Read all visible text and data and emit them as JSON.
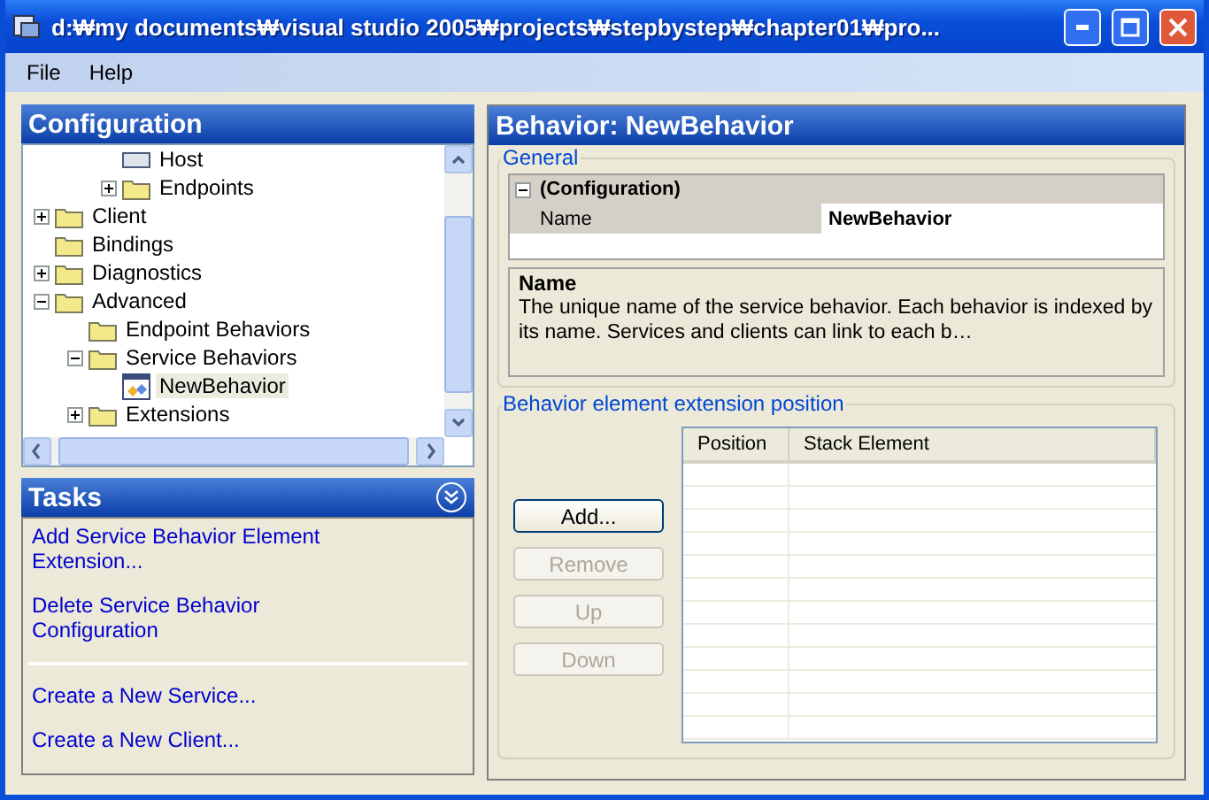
{
  "window": {
    "title": "d:₩my documents₩visual studio 2005₩projects₩stepbystep₩chapter01₩pro..."
  },
  "menu": [
    "File",
    "Help"
  ],
  "configuration": {
    "title": "Configuration",
    "tree": [
      {
        "children": [
          {
            "children": [
              {
                "label": "Host",
                "kind": "host",
                "selected": false
              },
              {
                "label": "Endpoints",
                "kind": "folder",
                "expanded": false,
                "selected": false
              }
            ]
          }
        ]
      },
      {
        "label": "Client",
        "kind": "folder",
        "expanded": false,
        "selected": false
      },
      {
        "label": "Bindings",
        "kind": "folder",
        "selected": false
      },
      {
        "label": "Diagnostics",
        "kind": "folder",
        "expanded": false,
        "selected": false
      },
      {
        "label": "Advanced",
        "kind": "folder",
        "expanded": true,
        "selected": false,
        "children": [
          {
            "label": "Endpoint Behaviors",
            "kind": "folder",
            "selected": false
          },
          {
            "label": "Service Behaviors",
            "kind": "folder",
            "expanded": true,
            "selected": false,
            "children": [
              {
                "label": "NewBehavior",
                "kind": "behavior",
                "selected": true
              }
            ]
          },
          {
            "label": "Extensions",
            "kind": "folder",
            "expanded": false,
            "selected": false
          }
        ]
      }
    ]
  },
  "tasks": {
    "title": "Tasks",
    "groups": [
      [
        "Add Service Behavior Element Extension...",
        "Delete Service Behavior Configuration"
      ],
      [
        "Create a New Service...",
        "Create a New Client..."
      ]
    ]
  },
  "behavior": {
    "title": "Behavior: NewBehavior",
    "general": {
      "legend": "General",
      "category": "(Configuration)",
      "expanded": true,
      "property": {
        "name": "Name",
        "value": "NewBehavior"
      },
      "help_title": "Name",
      "help_text": "The unique name of the service behavior. Each behavior is indexed by its name. Services and clients can link to each b…"
    },
    "extension": {
      "legend": "Behavior element extension position",
      "buttons": [
        {
          "label": "Add...",
          "disabled": false
        },
        {
          "label": "Remove",
          "disabled": true
        },
        {
          "label": "Up",
          "disabled": true
        },
        {
          "label": "Down",
          "disabled": true
        }
      ],
      "columns": [
        "Position",
        "Stack Element"
      ]
    }
  }
}
